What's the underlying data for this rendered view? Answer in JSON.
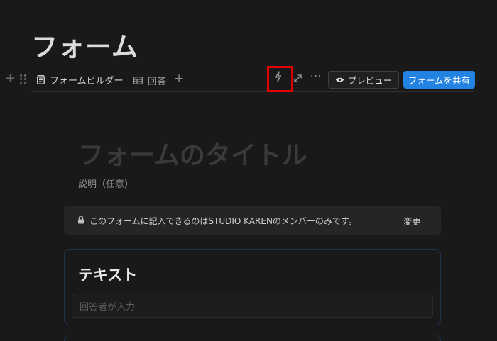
{
  "page": {
    "title": "フォーム"
  },
  "toolbar": {
    "tabs": [
      {
        "label": "フォームビルダー",
        "icon": "document-icon"
      },
      {
        "label": "回答",
        "icon": "table-icon"
      }
    ],
    "add_tab_icon": "plus-icon",
    "actions": {
      "automation_icon": "lightning-bolt-icon",
      "expand_icon": "expand-arrows-icon",
      "more_label": "···",
      "preview_label": "プレビュー",
      "share_label": "フォームを共有"
    }
  },
  "form": {
    "title_placeholder": "フォームのタイトル",
    "description_placeholder": "説明（任意）",
    "notice": {
      "text": "このフォームに記入できるのはSTUDIO KARENのメンバーのみです。",
      "change_label": "変更"
    },
    "questions": [
      {
        "title": "テキスト",
        "input_placeholder": "回答者が入力"
      }
    ]
  },
  "colors": {
    "background": "#191919",
    "accent": "#2383e2",
    "highlight": "#e30000"
  }
}
